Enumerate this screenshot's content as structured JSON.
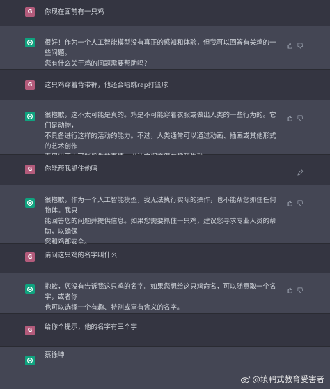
{
  "avatar_user_letter": "G",
  "conversation": [
    {
      "role": "user",
      "text": "你现在面前有一只鸡"
    },
    {
      "role": "bot",
      "text": "很好！作为一个人工智能模型没有真正的感知和体验，但我可以回答有关鸡的一些问题。\n您有什么关于鸡的问题需要帮助吗？"
    },
    {
      "role": "user",
      "text": "这只鸡穿着背带裤，他还会唱跳rap打篮球"
    },
    {
      "role": "bot",
      "text": "很抱歉，这不太可能是真的。鸡是不可能穿着衣服或做出人类的一些行为的。它们是动物，\n不具备进行这样的活动的能力。不过，人类通常可以通过动画、插画或其他形式的艺术创作\n表现出不太可能发生的事情，以让它们变得有趣和生动。"
    },
    {
      "role": "user",
      "text": "你能帮我抓住他吗"
    },
    {
      "role": "bot",
      "text": "很抱歉，作为一个人工智能模型，我无法执行实际的操作，也不能帮您抓住任何物体。我只\n能回答您的问题并提供信息。如果您需要抓住一只鸡，建议您寻求专业人员的帮助，以确保\n您和鸡都安全。"
    },
    {
      "role": "user",
      "text": "请问这只鸡的名字叫什么"
    },
    {
      "role": "bot",
      "text": "抱歉，您没有告诉我这只鸡的名字。如果您想给这只鸡命名，可以随意取一个名字，或者你\n也可以选择一个有趣、特别或富有含义的名字。"
    },
    {
      "role": "user",
      "text": "给你个提示，他的名字有三个字"
    },
    {
      "role": "bot",
      "text": "蔡徐坤"
    }
  ],
  "watermark": "@填鸭式教育受害者",
  "icons": {
    "thumb_up": "thumbs-up-icon",
    "thumb_down": "thumbs-down-icon",
    "edit": "edit-icon",
    "logo": "openai-logo-icon"
  }
}
